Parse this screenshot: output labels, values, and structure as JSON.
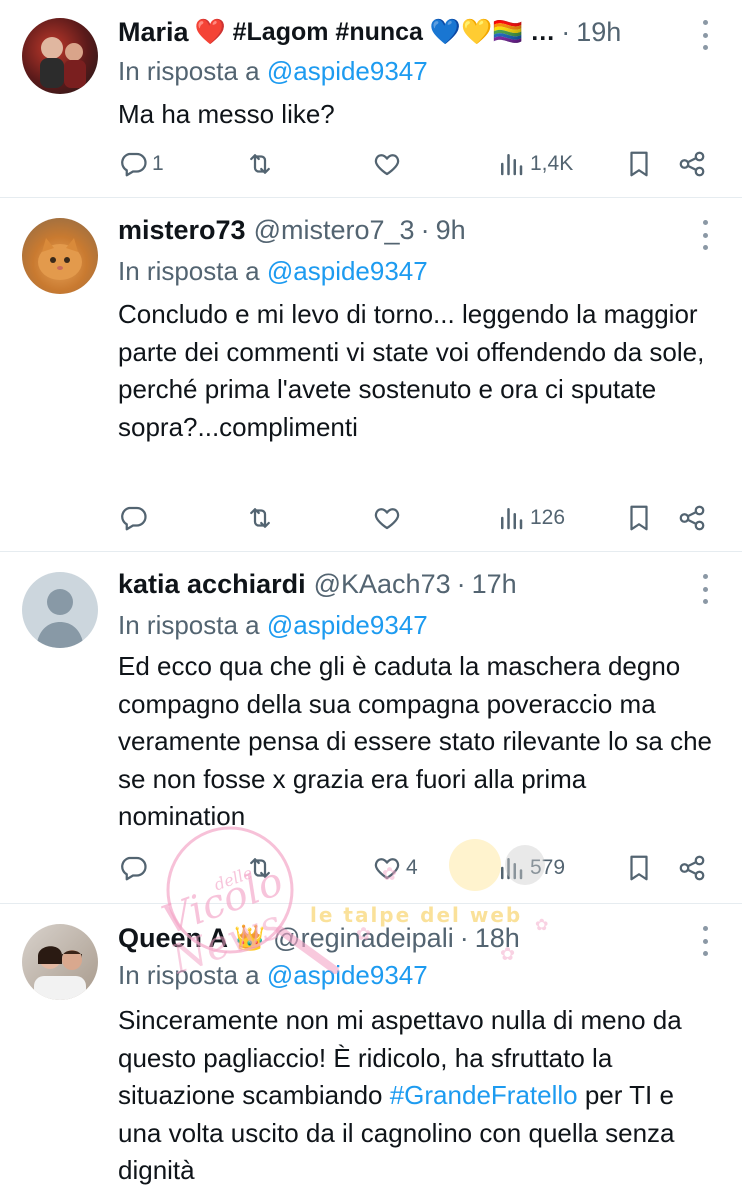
{
  "tweets": [
    {
      "name": "Maria",
      "emojis": "❤️ #Lagom #nunca 💙💛🏳️‍🌈 …",
      "handle": "",
      "time": "19h",
      "reply_prefix": "In risposta a",
      "reply_to": "@aspide9347",
      "text": "Ma ha messo like?",
      "replies": "1",
      "retweets": "",
      "likes": "",
      "views": "1,4K"
    },
    {
      "name": "mistero73",
      "emojis": "",
      "handle": "@mistero7_3",
      "time": "9h",
      "reply_prefix": "In risposta a",
      "reply_to": "@aspide9347",
      "text": "Concludo e mi levo di torno... leggendo la maggior parte dei commenti vi state voi offendendo da sole, perché prima l'avete sostenuto e ora ci sputate sopra?...complimenti",
      "replies": "",
      "retweets": "",
      "likes": "",
      "views": "126"
    },
    {
      "name": "katia acchiardi",
      "emojis": "",
      "handle": "@KAach73",
      "time": "17h",
      "reply_prefix": "In risposta a",
      "reply_to": "@aspide9347",
      "text": "Ed ecco qua che gli è caduta la maschera degno compagno della sua compagna poveraccio ma veramente pensa di essere stato rilevante lo sa che se non fosse x grazia era fuori alla prima nomination",
      "replies": "",
      "retweets": "",
      "likes": "4",
      "views": "579"
    },
    {
      "name": "Queen A",
      "emojis": "👑",
      "handle": "@reginadeipali",
      "time": "18h",
      "reply_prefix": "In risposta a",
      "reply_to": "@aspide9347",
      "text_before": "Sinceramente non mi aspettavo nulla di meno da questo pagliaccio! È ridicolo, ha sfruttato la situazione scambiando ",
      "hashtag": "#GrandeFratello",
      "text_after": " per TI e una volta uscito da il cagnolino con quella senza dignità"
    }
  ],
  "watermark": {
    "line1": "Vicolo",
    "line2": "delle",
    "line3": "News",
    "banner": "le talpe del web"
  },
  "colors": {
    "link": "#1d9bf0",
    "muted": "#536471",
    "text": "#0f1419"
  }
}
